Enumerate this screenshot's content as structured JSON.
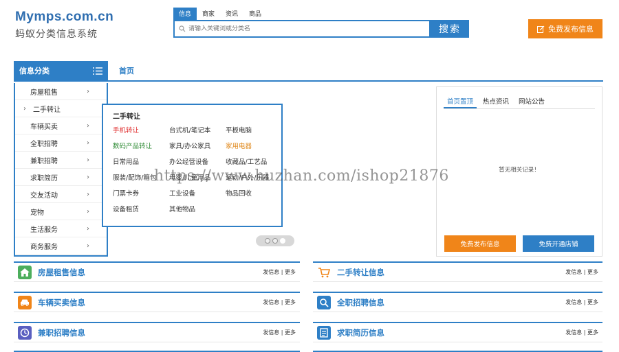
{
  "logo": {
    "title": "Mymps.com.cn",
    "subtitle": "蚂蚁分类信息系统"
  },
  "search": {
    "tabs": [
      "信息",
      "商家",
      "资讯",
      "商品"
    ],
    "placeholder": "请输入关键词或分类名",
    "button": "搜索"
  },
  "publish_button": "免费发布信息",
  "nav": {
    "category_title": "信息分类",
    "home": "首页"
  },
  "categories": [
    "房屋租售",
    "二手转让",
    "车辆买卖",
    "全职招聘",
    "兼职招聘",
    "求职简历",
    "交友活动",
    "宠物",
    "生活服务",
    "商务服务"
  ],
  "subcategory_popup": {
    "title": "二手转让",
    "items": [
      "手机转让",
      "台式机/笔记本",
      "平板电脑",
      "数码产品转让",
      "家具/办公家具",
      "家用电器",
      "日常用品",
      "办公经营设备",
      "收藏品/工艺品",
      "服装/配饰/箱包",
      "母婴/儿童用品",
      "运动/户外/乐器",
      "门票卡券",
      "工业设备",
      "物品回收",
      "设备租赁",
      "其他物品"
    ]
  },
  "news_panel": {
    "tabs": [
      "首页置顶",
      "热点资讯",
      "网站公告"
    ],
    "empty": "暂无相关记录！",
    "btn_publish": "免费发布信息",
    "btn_shop": "免费开通店铺"
  },
  "sections": [
    {
      "title": "房屋租售信息",
      "links": "发信息 | 更多",
      "icon": "home-icon",
      "color": "#4cae5c"
    },
    {
      "title": "二手转让信息",
      "links": "发信息 | 更多",
      "icon": "cart-icon",
      "color": "#f08519"
    },
    {
      "title": "车辆买卖信息",
      "links": "发信息 | 更多",
      "icon": "car-icon",
      "color": "#f08519"
    },
    {
      "title": "全职招聘信息",
      "links": "发信息 | 更多",
      "icon": "search-person-icon",
      "color": "#2e7fc6"
    },
    {
      "title": "兼职招聘信息",
      "links": "发信息 | 更多",
      "icon": "clock-icon",
      "color": "#5a5fc0"
    },
    {
      "title": "求职简历信息",
      "links": "发信息 | 更多",
      "icon": "resume-icon",
      "color": "#2e7fc6"
    }
  ],
  "watermark": "https://www.huzhan.com/ishop21876",
  "colors": {
    "accent": "#2e7fc6",
    "orange": "#f08519",
    "green": "#4cae5c"
  }
}
